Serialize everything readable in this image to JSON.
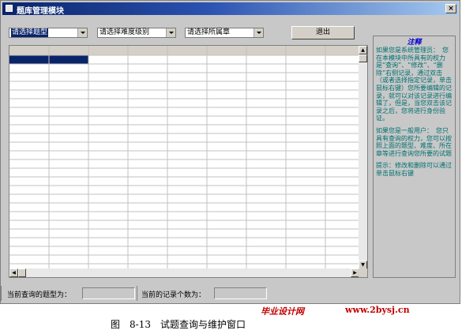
{
  "window": {
    "title": "题库管理模块",
    "close_label": "×"
  },
  "filters": [
    {
      "value": "请选择题型"
    },
    {
      "value": "请选择难度级别"
    },
    {
      "value": "请选择所属章"
    }
  ],
  "exit_label": "退出",
  "note": {
    "title": "注释",
    "paragraphs": [
      "如果您是系统管理员：　您在本模块中所具有的权力是“查询”、“修改”、“删除”右侧记录，通过双击（或者选择指定记录，单击鼠标右键）您所要编辑的记录，就可以对该记录进行编辑了，但是，当您双击该记录之后，您将进行身份验证。",
      "如果您是一般用户：　您只具有查询的权力，您可以按照上面的题型、难度、所在章等进行查询您所要的试题",
      "提示：修改和删除可以通过单击鼠标右键"
    ]
  },
  "status": {
    "type_label": "当前查询的题型为：",
    "type_value": "",
    "count_label": "当前的记录个数为：",
    "count_value": ""
  },
  "watermark": {
    "site_name": "毕业设计网",
    "url": "www.2bysj.cn"
  },
  "caption": "图　8-13　试题查询与维护窗口",
  "colors": {
    "selection": "#0a246a",
    "note_text": "#007070",
    "note_title": "#0000cc",
    "watermark": "#c00000"
  }
}
